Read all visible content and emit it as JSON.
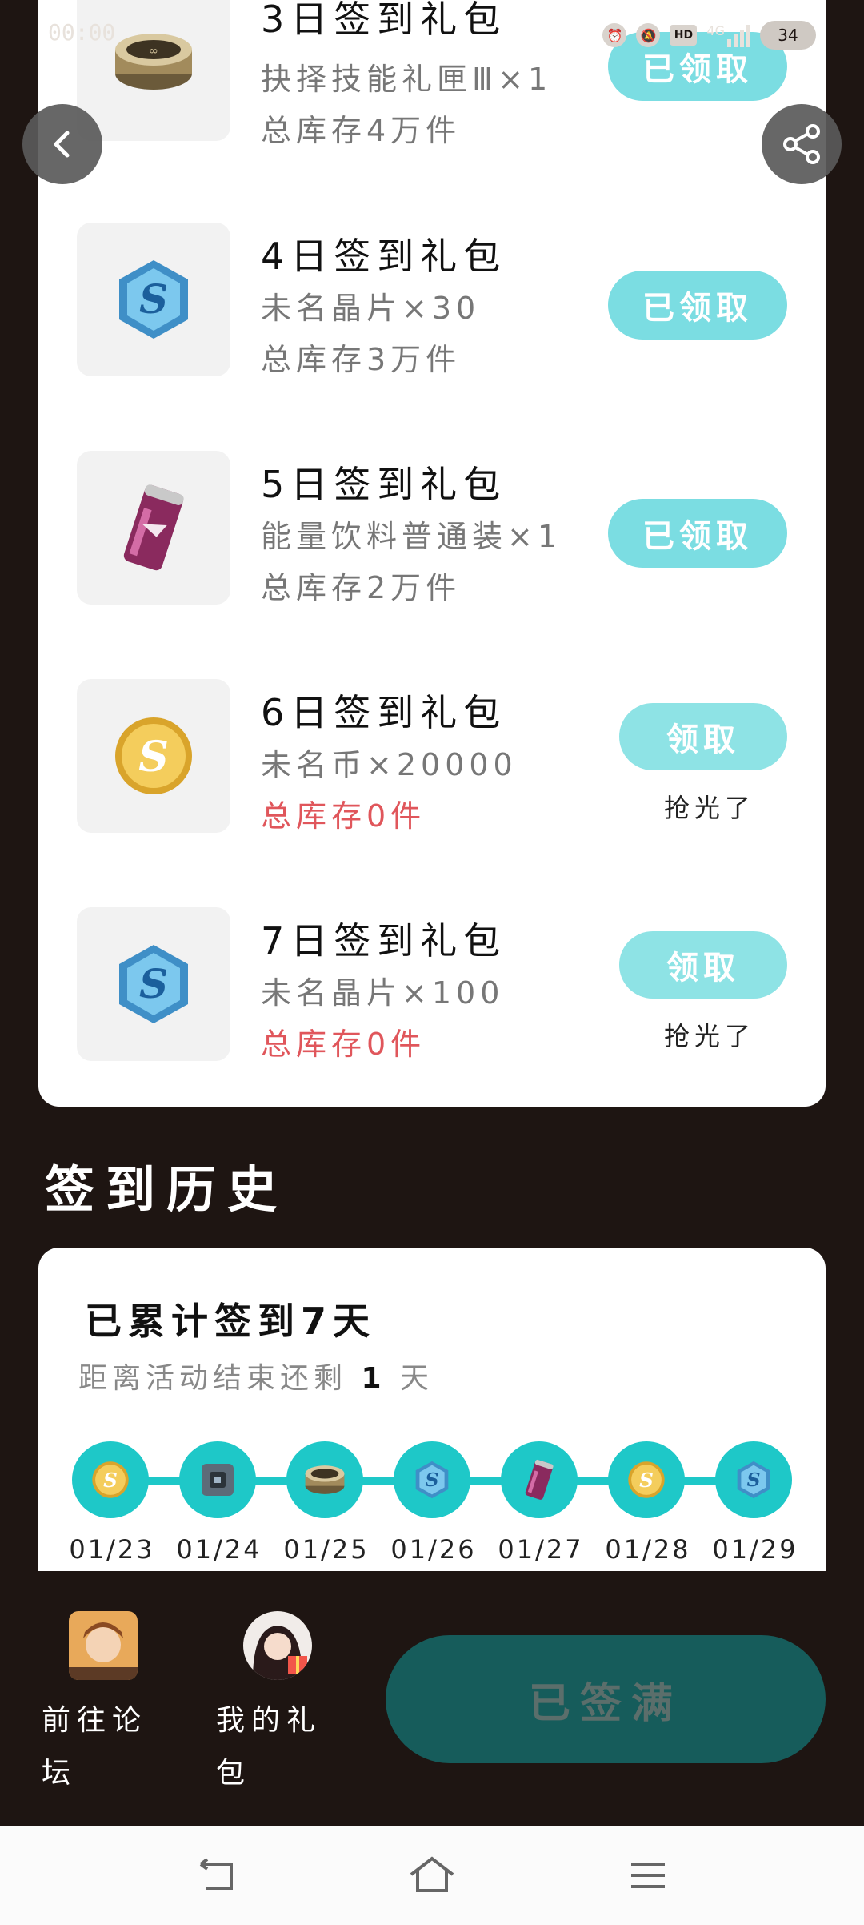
{
  "status_bar": {
    "time": "00:00",
    "hd": "HD",
    "network": "4G",
    "battery": "34"
  },
  "rewards": [
    {
      "title": "3日签到礼包",
      "desc": "抉择技能礼匣Ⅲ×1",
      "stock": "总库存4万件",
      "button": "已领取",
      "sold_out": "",
      "icon": "item-tin-icon",
      "state": "claimed"
    },
    {
      "title": "4日签到礼包",
      "desc": "未名晶片×30",
      "stock": "总库存3万件",
      "button": "已领取",
      "sold_out": "",
      "icon": "crystal-chip-icon",
      "state": "claimed"
    },
    {
      "title": "5日签到礼包",
      "desc": "能量饮料普通装×1",
      "stock": "总库存2万件",
      "button": "已领取",
      "sold_out": "",
      "icon": "energy-drink-icon",
      "state": "claimed"
    },
    {
      "title": "6日签到礼包",
      "desc": "未名币×20000",
      "stock": "总库存0件",
      "button": "领取",
      "sold_out": "抢光了",
      "icon": "coin-icon",
      "state": "sold_out"
    },
    {
      "title": "7日签到礼包",
      "desc": "未名晶片×100",
      "stock": "总库存0件",
      "button": "领取",
      "sold_out": "抢光了",
      "icon": "crystal-chip-icon",
      "state": "sold_out"
    }
  ],
  "history": {
    "heading": "签到历史",
    "title": "已累计签到7天",
    "sub_prefix": "距离活动结束还剩",
    "sub_days": "1",
    "sub_suffix": "天",
    "days": [
      {
        "date": "01/23",
        "icon": "coin-icon"
      },
      {
        "date": "01/24",
        "icon": "gift-box-icon"
      },
      {
        "date": "01/25",
        "icon": "item-tin-icon"
      },
      {
        "date": "01/26",
        "icon": "crystal-chip-icon"
      },
      {
        "date": "01/27",
        "icon": "energy-drink-icon"
      },
      {
        "date": "01/28",
        "icon": "coin-icon"
      },
      {
        "date": "01/29",
        "icon": "crystal-chip-icon"
      }
    ]
  },
  "bottom": {
    "forum_label": "前往论坛",
    "gifts_label": "我的礼包",
    "signin_button": "已签满"
  },
  "colors": {
    "accent": "#7bdde2",
    "timeline": "#1ec8c8",
    "empty_stock": "#e0565b",
    "signin_button": "#165c5b",
    "background": "#1e1512"
  }
}
